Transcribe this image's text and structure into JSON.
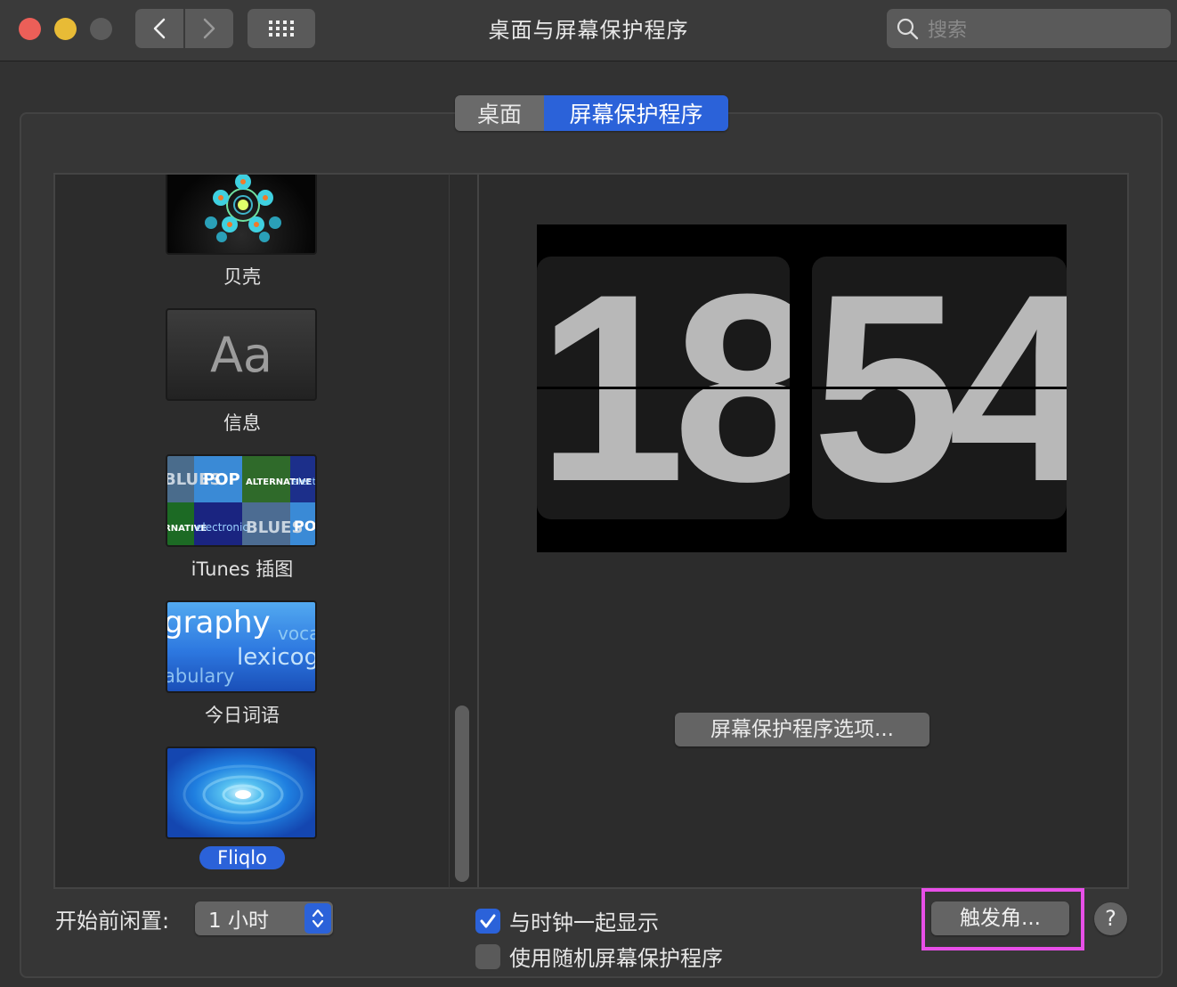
{
  "window": {
    "title": "桌面与屏幕保护程序",
    "search_placeholder": "搜索"
  },
  "icons": {
    "back": "chevron-left-icon",
    "forward": "chevron-right-icon",
    "show_all": "grid-icon",
    "search": "magnifier-icon",
    "stepper": "up-down-arrows-icon",
    "check": "checkmark-icon"
  },
  "tabs": [
    {
      "label": "桌面",
      "selected": false
    },
    {
      "label": "屏幕保护程序",
      "selected": true
    }
  ],
  "savers": [
    {
      "label": "贝壳",
      "selected": false
    },
    {
      "label": "信息",
      "selected": false,
      "thumb_text": "Aa"
    },
    {
      "label": "iTunes 插图",
      "selected": false,
      "thumb_tiles": [
        "BLUES",
        "POP",
        "ALTERNATIVE",
        "electronic",
        "ALTERNATIVE",
        "electronic",
        "BLUES",
        "POP"
      ]
    },
    {
      "label": "今日词语",
      "selected": false,
      "thumb_words": [
        "graphy",
        "voca",
        "lexicog",
        "abulary"
      ]
    },
    {
      "label": "Fliqlo",
      "selected": true
    }
  ],
  "preview": {
    "hours": "18",
    "minutes": "54",
    "options_button": "屏幕保护程序选项..."
  },
  "bottom": {
    "idle_label": "开始前闲置:",
    "idle_value": "1 小时",
    "show_clock_label": "与时钟一起显示",
    "show_clock_checked": true,
    "random_label": "使用随机屏幕保护程序",
    "random_checked": false,
    "hot_corners_button": "触发角...",
    "help_button": "?"
  },
  "colors": {
    "accent": "#2b62d9",
    "highlight_outline": "#e84fe8",
    "close": "#ec5f58",
    "minimize": "#e8bb36"
  }
}
